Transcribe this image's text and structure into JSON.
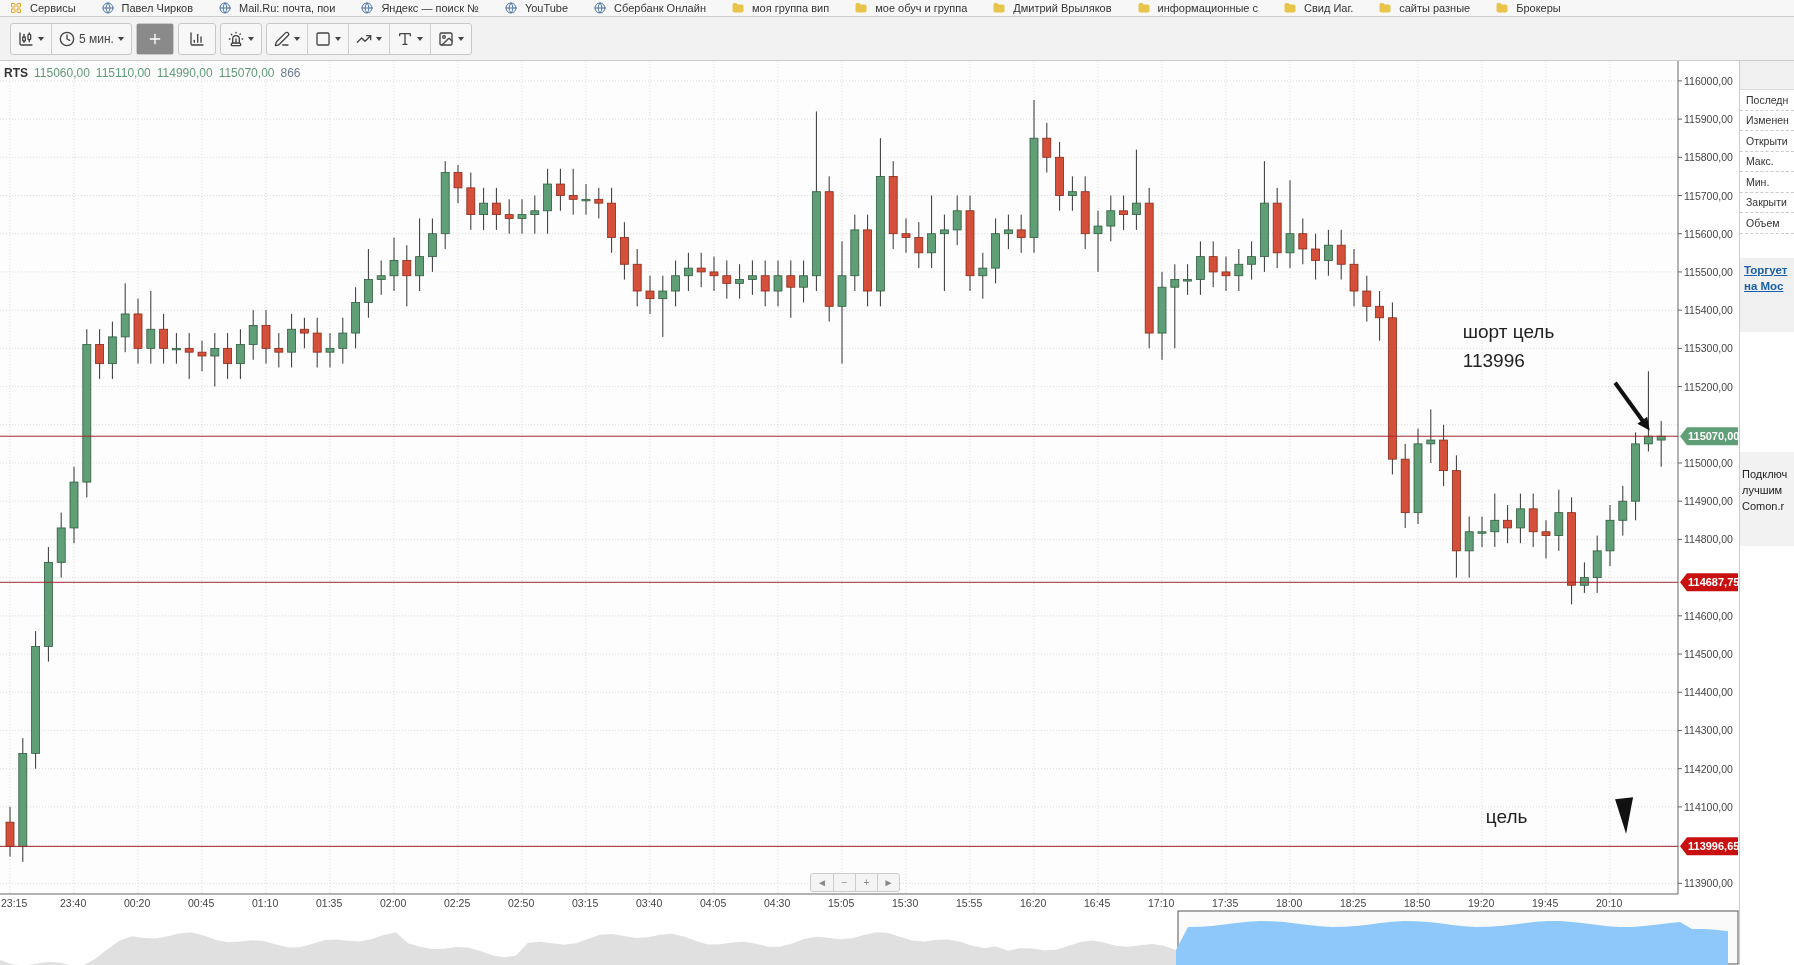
{
  "bookmarks": [
    {
      "label": "Сервисы",
      "kind": "apps"
    },
    {
      "label": "Павел Чирков",
      "kind": "site"
    },
    {
      "label": "Mail.Ru: почта, пои",
      "kind": "site"
    },
    {
      "label": "Яндекс — поиск №",
      "kind": "site"
    },
    {
      "label": "YouTube",
      "kind": "site"
    },
    {
      "label": "Сбербанк Онлайн",
      "kind": "site"
    },
    {
      "label": "моя группа вип",
      "kind": "folder"
    },
    {
      "label": "мое обуч и группа",
      "kind": "folder"
    },
    {
      "label": "Дмитрий Врыляков",
      "kind": "folder"
    },
    {
      "label": "информационные с",
      "kind": "folder"
    },
    {
      "label": "Свид Иаг.",
      "kind": "folder"
    },
    {
      "label": "сайты разные",
      "kind": "folder"
    },
    {
      "label": "Брокеры",
      "kind": "folder"
    }
  ],
  "toolbar": {
    "groups": [
      [
        {
          "has_menu": true,
          "selected": false
        },
        {
          "label": "5 мин.",
          "has_menu": true,
          "selected": false
        }
      ],
      [
        {
          "has_menu": false,
          "selected": true
        }
      ],
      [
        {
          "has_menu": false,
          "selected": false
        }
      ],
      [
        {
          "has_menu": true,
          "selected": false
        }
      ],
      [
        {
          "has_menu": true,
          "selected": false
        },
        {
          "has_menu": true,
          "selected": false
        },
        {
          "has_menu": true,
          "selected": false
        },
        {
          "has_menu": true,
          "selected": false
        },
        {
          "has_menu": true,
          "selected": false
        }
      ]
    ]
  },
  "header": {
    "symbol": "RTS",
    "values": [
      "115060,00",
      "115110,00",
      "114990,00",
      "115070,00"
    ],
    "volume": "866"
  },
  "chart_data": {
    "type": "candlestick",
    "ylim": [
      113872,
      116052
    ],
    "grid": true,
    "ref_lines": [
      {
        "axis": "y",
        "value": 115070,
        "label": "115070,00",
        "color": "#a0262a"
      },
      {
        "axis": "y",
        "value": 114687.75,
        "label": "114687,75",
        "color": "#a0262a"
      },
      {
        "axis": "y",
        "value": 113996.65,
        "label": "113996,65",
        "color": "#a0262a"
      }
    ],
    "yticks": [
      {
        "value": 116000,
        "label": "116000,00"
      },
      {
        "value": 115900,
        "label": "115900,00"
      },
      {
        "value": 115800,
        "label": "115800,00"
      },
      {
        "value": 115700,
        "label": "115700,00"
      },
      {
        "value": 115600,
        "label": "115600,00"
      },
      {
        "value": 115500,
        "label": "115500,00"
      },
      {
        "value": 115400,
        "label": "115400,00"
      },
      {
        "value": 115300,
        "label": "115300,00"
      },
      {
        "value": 115200,
        "label": "115200,00"
      },
      {
        "value": 115000,
        "label": "115000,00"
      },
      {
        "value": 114900,
        "label": "114900,00"
      },
      {
        "value": 114800,
        "label": "114800,00"
      },
      {
        "value": 114600,
        "label": "114600,00"
      },
      {
        "value": 114500,
        "label": "114500,00"
      },
      {
        "value": 114400,
        "label": "114400,00"
      },
      {
        "value": 114300,
        "label": "114300,00"
      },
      {
        "value": 114200,
        "label": "114200,00"
      },
      {
        "value": 114100,
        "label": "114100,00"
      },
      {
        "value": 113900,
        "label": "113900,00"
      }
    ],
    "categories": [
      "23:15",
      null,
      null,
      null,
      null,
      "23:40",
      null,
      null,
      null,
      null,
      "00:20",
      null,
      null,
      null,
      null,
      "00:45",
      null,
      null,
      null,
      null,
      "01:10",
      null,
      null,
      null,
      null,
      "01:35",
      null,
      null,
      null,
      null,
      "02:00",
      null,
      null,
      null,
      null,
      "02:25",
      null,
      null,
      null,
      null,
      "02:50",
      null,
      null,
      null,
      null,
      "03:15",
      null,
      null,
      null,
      null,
      "03:40",
      null,
      null,
      null,
      null,
      "04:05",
      null,
      null,
      null,
      null,
      "04:30",
      null,
      null,
      null,
      null,
      "15:05",
      null,
      null,
      null,
      null,
      "15:30",
      null,
      null,
      null,
      null,
      "15:55",
      null,
      null,
      null,
      null,
      "16:20",
      null,
      null,
      null,
      null,
      "16:45",
      null,
      null,
      null,
      null,
      "17:10",
      null,
      null,
      null,
      null,
      "17:35",
      null,
      null,
      null,
      null,
      "18:00",
      null,
      null,
      null,
      null,
      "18:25",
      null,
      null,
      null,
      null,
      "18:50",
      null,
      null,
      null,
      null,
      "19:20",
      null,
      null,
      null,
      null,
      "19:45",
      null,
      null,
      null,
      null,
      "20:10",
      null,
      null,
      null,
      null
    ],
    "ohlc": [
      [
        114060,
        114100,
        113970,
        113996
      ],
      [
        113996,
        114280,
        113956,
        114240
      ],
      [
        114240,
        114560,
        114200,
        114520
      ],
      [
        114520,
        114780,
        114480,
        114740
      ],
      [
        114740,
        114870,
        114700,
        114830
      ],
      [
        114830,
        114990,
        114790,
        114950
      ],
      [
        114950,
        115350,
        114910,
        115310
      ],
      [
        115310,
        115350,
        115220,
        115260
      ],
      [
        115260,
        115370,
        115220,
        115330
      ],
      [
        115330,
        115470,
        115290,
        115390
      ],
      [
        115390,
        115430,
        115260,
        115300
      ],
      [
        115300,
        115450,
        115260,
        115350
      ],
      [
        115350,
        115390,
        115260,
        115300
      ],
      [
        115300,
        115340,
        115260,
        115300
      ],
      [
        115300,
        115340,
        115220,
        115290
      ],
      [
        115290,
        115320,
        115240,
        115280
      ],
      [
        115280,
        115340,
        115200,
        115300
      ],
      [
        115300,
        115340,
        115220,
        115260
      ],
      [
        115260,
        115350,
        115220,
        115310
      ],
      [
        115310,
        115400,
        115270,
        115360
      ],
      [
        115360,
        115400,
        115260,
        115300
      ],
      [
        115300,
        115340,
        115250,
        115290
      ],
      [
        115290,
        115390,
        115250,
        115350
      ],
      [
        115350,
        115380,
        115300,
        115340
      ],
      [
        115340,
        115380,
        115250,
        115290
      ],
      [
        115290,
        115340,
        115250,
        115300
      ],
      [
        115300,
        115380,
        115260,
        115340
      ],
      [
        115340,
        115460,
        115300,
        115420
      ],
      [
        115420,
        115560,
        115380,
        115480
      ],
      [
        115480,
        115530,
        115440,
        115490
      ],
      [
        115490,
        115590,
        115450,
        115530
      ],
      [
        115530,
        115570,
        115410,
        115490
      ],
      [
        115490,
        115640,
        115450,
        115540
      ],
      [
        115540,
        115640,
        115500,
        115600
      ],
      [
        115600,
        115790,
        115560,
        115760
      ],
      [
        115760,
        115780,
        115680,
        115720
      ],
      [
        115720,
        115760,
        115610,
        115650
      ],
      [
        115650,
        115720,
        115610,
        115680
      ],
      [
        115680,
        115720,
        115610,
        115650
      ],
      [
        115650,
        115690,
        115600,
        115640
      ],
      [
        115640,
        115690,
        115600,
        115650
      ],
      [
        115650,
        115700,
        115600,
        115660
      ],
      [
        115660,
        115770,
        115600,
        115730
      ],
      [
        115730,
        115770,
        115660,
        115700
      ],
      [
        115700,
        115770,
        115650,
        115690
      ],
      [
        115690,
        115730,
        115650,
        115690
      ],
      [
        115690,
        115720,
        115640,
        115680
      ],
      [
        115680,
        115720,
        115550,
        115590
      ],
      [
        115590,
        115630,
        115480,
        115520
      ],
      [
        115520,
        115560,
        115410,
        115450
      ],
      [
        115450,
        115490,
        115390,
        115430
      ],
      [
        115430,
        115490,
        115330,
        115450
      ],
      [
        115450,
        115530,
        115410,
        115490
      ],
      [
        115490,
        115550,
        115450,
        115510
      ],
      [
        115510,
        115550,
        115460,
        115500
      ],
      [
        115500,
        115540,
        115450,
        115490
      ],
      [
        115490,
        115530,
        115430,
        115470
      ],
      [
        115470,
        115520,
        115430,
        115480
      ],
      [
        115480,
        115530,
        115440,
        115490
      ],
      [
        115490,
        115530,
        115410,
        115450
      ],
      [
        115450,
        115530,
        115410,
        115490
      ],
      [
        115490,
        115530,
        115380,
        115460
      ],
      [
        115460,
        115530,
        115420,
        115490
      ],
      [
        115490,
        115920,
        115450,
        115710
      ],
      [
        115710,
        115750,
        115370,
        115410
      ],
      [
        115410,
        115580,
        115260,
        115490
      ],
      [
        115490,
        115650,
        115450,
        115610
      ],
      [
        115610,
        115650,
        115410,
        115450
      ],
      [
        115450,
        115850,
        115410,
        115750
      ],
      [
        115750,
        115790,
        115560,
        115600
      ],
      [
        115600,
        115640,
        115550,
        115590
      ],
      [
        115590,
        115630,
        115510,
        115550
      ],
      [
        115550,
        115700,
        115510,
        115600
      ],
      [
        115600,
        115650,
        115450,
        115610
      ],
      [
        115610,
        115700,
        115570,
        115660
      ],
      [
        115660,
        115700,
        115450,
        115490
      ],
      [
        115490,
        115550,
        115430,
        115510
      ],
      [
        115510,
        115640,
        115470,
        115600
      ],
      [
        115600,
        115650,
        115560,
        115610
      ],
      [
        115610,
        115650,
        115550,
        115590
      ],
      [
        115590,
        115950,
        115550,
        115850
      ],
      [
        115850,
        115890,
        115760,
        115800
      ],
      [
        115800,
        115840,
        115660,
        115700
      ],
      [
        115700,
        115750,
        115660,
        115710
      ],
      [
        115710,
        115750,
        115560,
        115600
      ],
      [
        115600,
        115660,
        115500,
        115620
      ],
      [
        115620,
        115700,
        115580,
        115660
      ],
      [
        115660,
        115700,
        115610,
        115650
      ],
      [
        115650,
        115820,
        115610,
        115680
      ],
      [
        115680,
        115720,
        115300,
        115340
      ],
      [
        115340,
        115500,
        115270,
        115460
      ],
      [
        115460,
        115520,
        115300,
        115480
      ],
      [
        115480,
        115520,
        115440,
        115480
      ],
      [
        115480,
        115580,
        115440,
        115540
      ],
      [
        115540,
        115580,
        115460,
        115500
      ],
      [
        115500,
        115540,
        115450,
        115490
      ],
      [
        115490,
        115560,
        115450,
        115520
      ],
      [
        115520,
        115580,
        115480,
        115540
      ],
      [
        115540,
        115790,
        115500,
        115680
      ],
      [
        115680,
        115720,
        115510,
        115550
      ],
      [
        115550,
        115740,
        115510,
        115600
      ],
      [
        115600,
        115640,
        115520,
        115560
      ],
      [
        115560,
        115600,
        115480,
        115530
      ],
      [
        115530,
        115610,
        115490,
        115570
      ],
      [
        115570,
        115610,
        115480,
        115520
      ],
      [
        115520,
        115560,
        115410,
        115450
      ],
      [
        115450,
        115490,
        115370,
        115410
      ],
      [
        115410,
        115450,
        115320,
        115380
      ],
      [
        115380,
        115420,
        114970,
        115010
      ],
      [
        115010,
        115050,
        114830,
        114870
      ],
      [
        114870,
        115090,
        114840,
        115050
      ],
      [
        115050,
        115140,
        115000,
        115060
      ],
      [
        115060,
        115100,
        114940,
        114980
      ],
      [
        114980,
        115020,
        114700,
        114770
      ],
      [
        114770,
        114860,
        114700,
        114820
      ],
      [
        114820,
        114860,
        114780,
        114820
      ],
      [
        114820,
        114920,
        114780,
        114850
      ],
      [
        114850,
        114890,
        114790,
        114830
      ],
      [
        114830,
        114920,
        114790,
        114880
      ],
      [
        114880,
        114920,
        114780,
        114820
      ],
      [
        114820,
        114850,
        114750,
        114810
      ],
      [
        114810,
        114930,
        114770,
        114870
      ],
      [
        114870,
        114910,
        114630,
        114680
      ],
      [
        114680,
        114740,
        114660,
        114700
      ],
      [
        114700,
        114810,
        114660,
        114770
      ],
      [
        114770,
        114890,
        114730,
        114850
      ],
      [
        114850,
        114940,
        114810,
        114900
      ],
      [
        114900,
        115080,
        114850,
        115050
      ],
      [
        115050,
        115240,
        115030,
        115070
      ],
      [
        115060,
        115110,
        114990,
        115070
      ]
    ]
  },
  "price_tags": [
    {
      "color": "#5f9e76"
    },
    {
      "color": "#c81010"
    },
    {
      "color": "#c81010"
    }
  ],
  "notes": [
    "шорт цель",
    "113996",
    "цель"
  ],
  "zoom_controls": [
    "◄",
    "−",
    "+",
    "►"
  ],
  "quote_panel": {
    "rows": [
      "Последн",
      "Изменен",
      "Открыти",
      "Макс.",
      "Мин.",
      "Закрыти",
      "Объем"
    ],
    "link": [
      "Торгует",
      "на Мос"
    ],
    "promo": [
      "Подключ",
      "лучшим",
      "Comon.r"
    ]
  }
}
